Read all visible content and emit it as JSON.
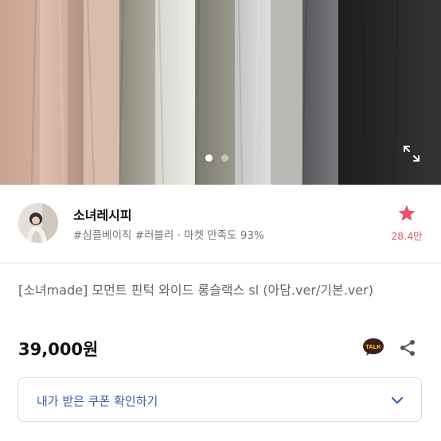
{
  "gallery": {
    "page_count": 2,
    "active_index": 0,
    "expand_icon": "expand-icon"
  },
  "seller": {
    "name": "소녀레시피",
    "tags": "#심플베이직 #러블리 · 마켓 만족도 93%",
    "favorite_count": "28.4만",
    "favorite_icon": "star-icon",
    "favorite_color": "#e9506a"
  },
  "product": {
    "title": "[소녀made] 모먼트 핀턱 와이드 롱슬랙스 sl (아담.ver/기본.ver)",
    "price": "39,000원",
    "talk_label": "TALK"
  },
  "coupon": {
    "label": "내가 받은 쿠폰 확인하기",
    "chevron_icon": "chevron-down-icon",
    "accent": "#3b5fa8"
  }
}
